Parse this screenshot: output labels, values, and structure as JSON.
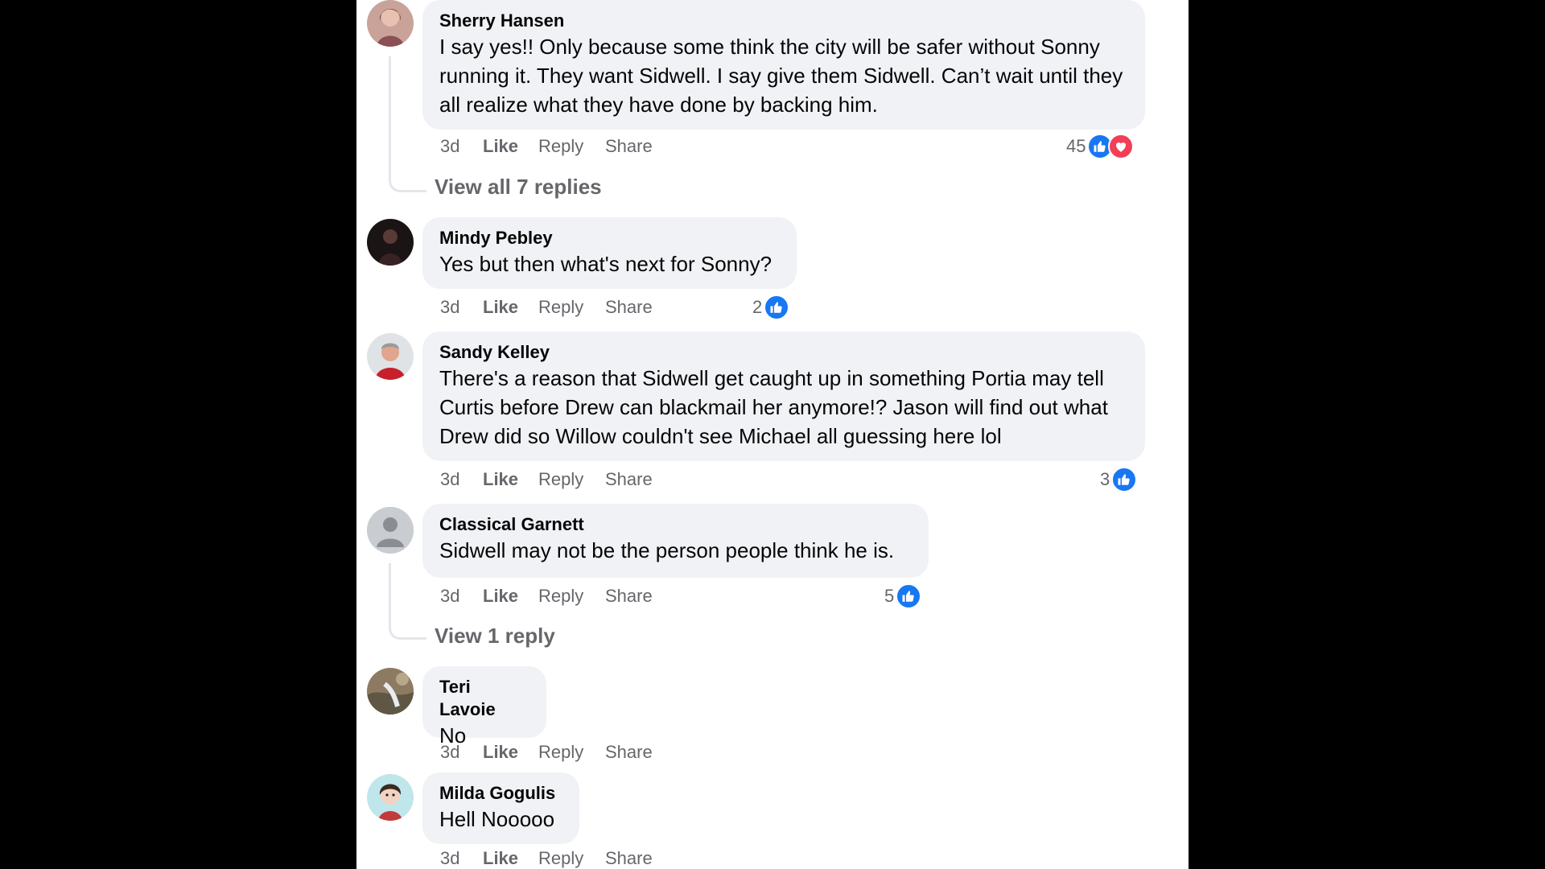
{
  "comments": [
    {
      "author": "Sherry Hansen",
      "text": "I say yes!! Only because some think the city will be safer without Sonny running it. They want Sidwell. I say give them Sidwell. Can’t wait until they all realize what they have done by backing him.",
      "time": "3d",
      "like": "Like",
      "reply": "Reply",
      "share": "Share",
      "reaction_count": "45",
      "reactions": [
        "like-icon",
        "love-icon"
      ],
      "view_replies": "View all 7 replies"
    },
    {
      "author": "Mindy Pebley",
      "text": "Yes but then what's next for Sonny?",
      "time": "3d",
      "like": "Like",
      "reply": "Reply",
      "share": "Share",
      "reaction_count": "2",
      "reactions": [
        "like-icon"
      ]
    },
    {
      "author": "Sandy Kelley",
      "text": "There's a reason that Sidwell get caught up in something Portia may tell Curtis before Drew can blackmail her anymore!? Jason will find out what Drew did so Willow couldn't see Michael all guessing here lol",
      "time": "3d",
      "like": "Like",
      "reply": "Reply",
      "share": "Share",
      "reaction_count": "3",
      "reactions": [
        "like-icon"
      ]
    },
    {
      "author": "Classical Garnett",
      "text": "Sidwell may not be the person people think he is.",
      "time": "3d",
      "like": "Like",
      "reply": "Reply",
      "share": "Share",
      "reaction_count": "5",
      "reactions": [
        "like-icon"
      ],
      "view_replies": "View 1 reply"
    },
    {
      "author": "Teri Lavoie",
      "text": "No",
      "time": "3d",
      "like": "Like",
      "reply": "Reply",
      "share": "Share"
    },
    {
      "author": "Milda Gogulis",
      "text": "Hell Nooooo",
      "time": "3d",
      "like": "Like",
      "reply": "Reply",
      "share": "Share"
    }
  ],
  "colors": {
    "bubble": "#f0f2f5",
    "meta_text": "#65676b",
    "like_blue": "#1877f2",
    "love_red": "#f33e58"
  }
}
